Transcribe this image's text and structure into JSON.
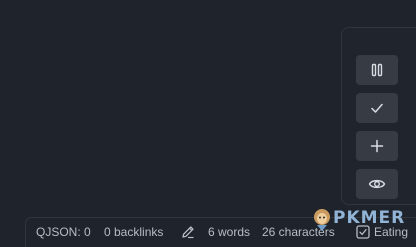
{
  "colors": {
    "background": "#1f232b",
    "toolbar_button": "#363b44",
    "icon": "#d9dce1",
    "status_text": "#b8bcc4",
    "watermark": "#9ec3e8"
  },
  "toolbar": {
    "buttons": [
      {
        "icon": "pause-icon",
        "name": "pause-button"
      },
      {
        "icon": "check-icon",
        "name": "check-button"
      },
      {
        "icon": "plus-icon",
        "name": "add-button"
      },
      {
        "icon": "eye-icon",
        "name": "preview-button"
      }
    ]
  },
  "status_bar": {
    "qjson": "QJSON: 0",
    "backlinks": "0 backlinks",
    "edit_icon": "pencil-icon",
    "words": "6 words",
    "characters": "26 characters",
    "task_icon": "checkbox-icon",
    "task": "Eating"
  },
  "watermark": {
    "text": "PKMER"
  }
}
